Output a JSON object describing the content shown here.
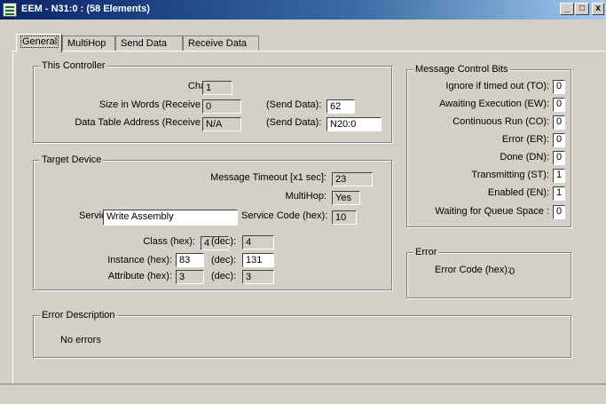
{
  "window": {
    "title": "EEM - N31:0 : (58 Elements)",
    "min": "_",
    "max": "□",
    "close": "x"
  },
  "tabs": [
    "General",
    "MultiHop",
    "Send Data",
    "Receive Data"
  ],
  "this_controller": {
    "legend": "This Controller",
    "channel_label": "Channel :",
    "channel_value": "1",
    "size_label": "Size in Words (Receive Data):",
    "size_value": "0",
    "size_send_label": "(Send Data):",
    "size_send_value": "62",
    "addr_label": "Data Table Address (Receive Data):",
    "addr_value": "N/A",
    "addr_send_label": "(Send Data):",
    "addr_send_value": "N20:0"
  },
  "target_device": {
    "legend": "Target Device",
    "timeout_label": "Message Timeout [x1 sec]:",
    "timeout_value": "23",
    "multihop_label": "MultiHop:",
    "multihop_value": "Yes",
    "service_label": "Service:",
    "service_value": "Write Assembly",
    "service_code_label": "Service Code (hex):",
    "service_code_value": "10",
    "class_label": "Class (hex):",
    "class_hex": "4",
    "class_dec_label": "(dec):",
    "class_dec": "4",
    "instance_label": "Instance (hex):",
    "instance_hex": "83",
    "instance_dec_label": "(dec):",
    "instance_dec": "131",
    "attribute_label": "Attribute (hex):",
    "attribute_hex": "3",
    "attribute_dec_label": "(dec):",
    "attribute_dec": "3"
  },
  "control_bits": {
    "legend": "Message Control Bits",
    "bits": [
      {
        "label": "Ignore if timed out (TO):",
        "value": "0"
      },
      {
        "label": "Awaiting Execution (EW):",
        "value": "0"
      },
      {
        "label": "Continuous Run (CO):",
        "value": "0"
      },
      {
        "label": "Error (ER):",
        "value": "0"
      },
      {
        "label": "Done (DN):",
        "value": "0"
      },
      {
        "label": "Transmitting (ST):",
        "value": "1"
      },
      {
        "label": "Enabled (EN):",
        "value": "1"
      },
      {
        "label": "Waiting for Queue Space :",
        "value": "0"
      }
    ]
  },
  "error": {
    "legend": "Error",
    "code_label": "Error Code (hex):",
    "code_value": "0"
  },
  "error_description": {
    "legend": "Error Description",
    "text": "No errors"
  }
}
